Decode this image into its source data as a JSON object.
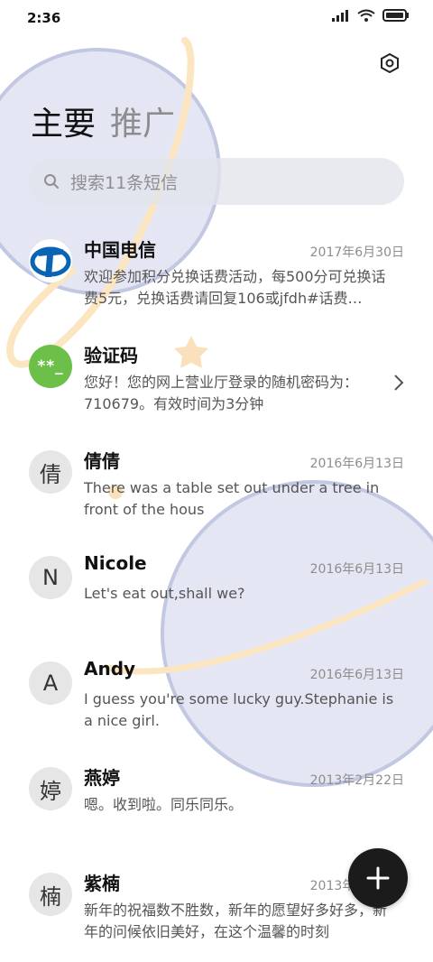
{
  "status_bar": {
    "time": "2:36"
  },
  "tabs": [
    {
      "label": "主要",
      "active": true
    },
    {
      "label": "推广",
      "active": false
    }
  ],
  "search": {
    "placeholder": "搜索11条短信"
  },
  "conversations": [
    {
      "name": "中国电信",
      "date": "2017年6月30日",
      "preview": "欢迎参加积分兑换话费活动，每500分可兑换话费5元，兑换话费请回复106或jfdh#话费…",
      "avatar": "telecom-logo"
    },
    {
      "name": "验证码",
      "date": "",
      "preview": "您好！您的网上营业厅登录的随机密码为：710679。有效时间为3分钟",
      "avatar_text": "**_"
    },
    {
      "name": "倩倩",
      "date": "2016年6月13日",
      "preview": "There was a table set out under a tree in front of the hous",
      "avatar_text": "倩"
    },
    {
      "name": "Nicole",
      "date": "2016年6月13日",
      "preview": "Let's eat out,shall we?",
      "avatar_text": "N"
    },
    {
      "name": "Andy",
      "date": "2016年6月13日",
      "preview": "I guess you're some lucky guy.Stephanie is a nice girl.",
      "avatar_text": "A"
    },
    {
      "name": "燕婷",
      "date": "2013年2月22日",
      "preview": "嗯。收到啦。同乐同乐。",
      "avatar_text": "婷"
    },
    {
      "name": "紫楠",
      "date": "2013年2月22日",
      "preview": "新年的祝福数不胜数，新年的愿望好多好多，新年的问候依旧美好，在这个温馨的时刻",
      "avatar_text": "楠"
    }
  ],
  "colors": {
    "accent": "#1b1b1b",
    "green_avatar": "#6cc04a",
    "planet": "#c9cee6",
    "ring": "#fbe6c1"
  }
}
